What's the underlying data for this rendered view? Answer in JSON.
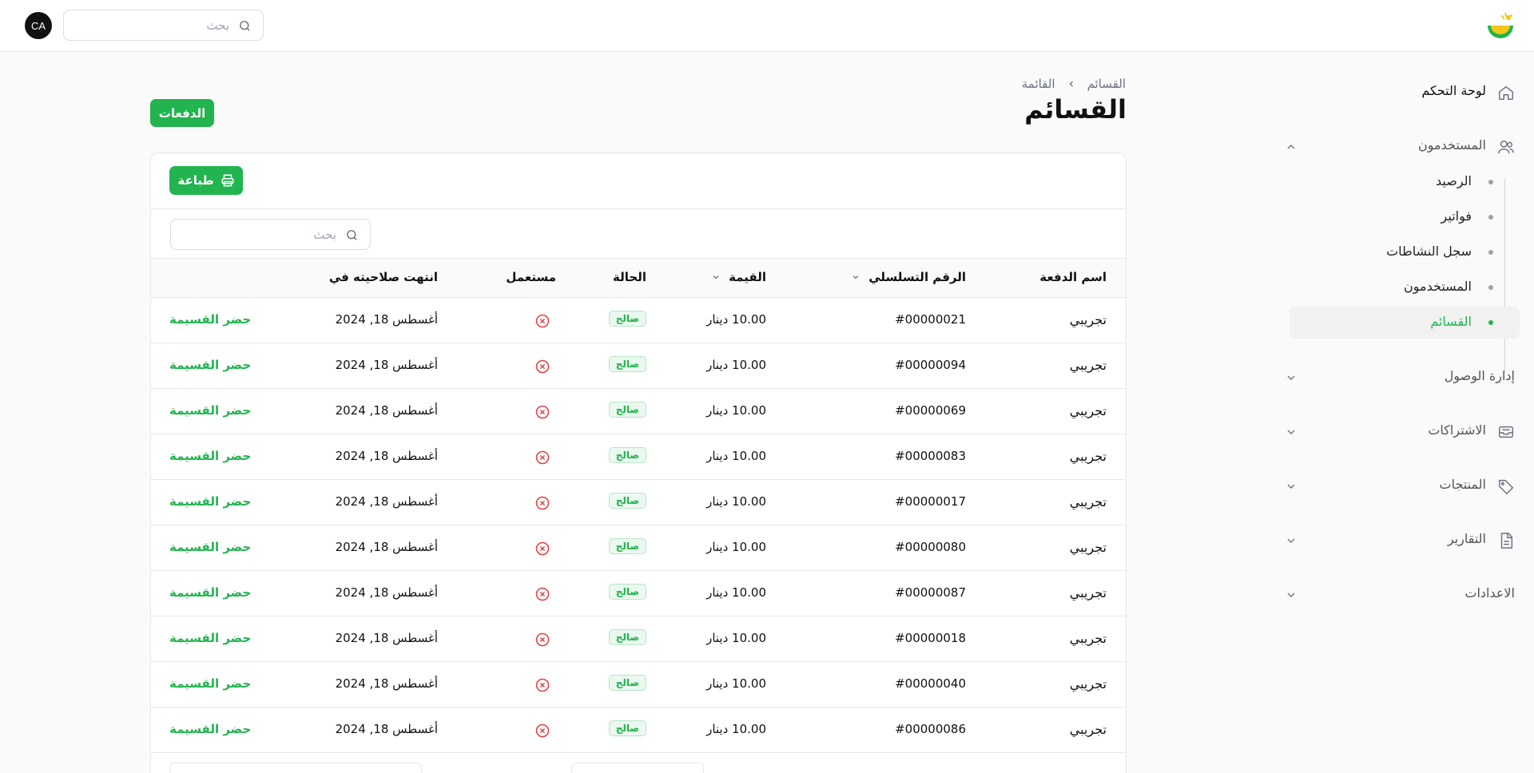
{
  "topbar": {
    "search_placeholder": "بحث",
    "avatar_initials": "CA"
  },
  "sidebar": {
    "dashboard": "لوحة التحكم",
    "users_group": "المستخدمون",
    "sub_items": [
      {
        "label": "الرصيد"
      },
      {
        "label": "فواتير"
      },
      {
        "label": "سجل النشاطات"
      },
      {
        "label": "المستخدمون"
      },
      {
        "label": "القسائم"
      }
    ],
    "access": "إدارة الوصول",
    "subscriptions": "الاشتراكات",
    "products": "المنتجات",
    "reports": "التقارير",
    "settings": "الاعدادات"
  },
  "breadcrumb": {
    "first": "القسائم",
    "second": "القائمة"
  },
  "page_title": "القسائم",
  "payments_button": "الدفعات",
  "print_button": "طباعة",
  "table": {
    "search_placeholder": "بحث",
    "headers": {
      "name": "اسم الدفعة",
      "serial": "الرقم التسلسلي",
      "value": "القيمة",
      "status": "الحالة",
      "used": "مستعمل",
      "expires": "انتهت صلاحيته في"
    },
    "rows": [
      {
        "name": "تجريبي",
        "serial": "#00000021",
        "value": "10.00 دينار",
        "status": "صالح",
        "expires": "أغسطس 18, 2024",
        "action": "حضر القسيمة"
      },
      {
        "name": "تجريبي",
        "serial": "#00000094",
        "value": "10.00 دينار",
        "status": "صالح",
        "expires": "أغسطس 18, 2024",
        "action": "حضر القسيمة"
      },
      {
        "name": "تجريبي",
        "serial": "#00000069",
        "value": "10.00 دينار",
        "status": "صالح",
        "expires": "أغسطس 18, 2024",
        "action": "حضر القسيمة"
      },
      {
        "name": "تجريبي",
        "serial": "#00000083",
        "value": "10.00 دينار",
        "status": "صالح",
        "expires": "أغسطس 18, 2024",
        "action": "حضر القسيمة"
      },
      {
        "name": "تجريبي",
        "serial": "#00000017",
        "value": "10.00 دينار",
        "status": "صالح",
        "expires": "أغسطس 18, 2024",
        "action": "حضر القسيمة"
      },
      {
        "name": "تجريبي",
        "serial": "#00000080",
        "value": "10.00 دينار",
        "status": "صالح",
        "expires": "أغسطس 18, 2024",
        "action": "حضر القسيمة"
      },
      {
        "name": "تجريبي",
        "serial": "#00000087",
        "value": "10.00 دينار",
        "status": "صالح",
        "expires": "أغسطس 18, 2024",
        "action": "حضر القسيمة"
      },
      {
        "name": "تجريبي",
        "serial": "#00000018",
        "value": "10.00 دينار",
        "status": "صالح",
        "expires": "أغسطس 18, 2024",
        "action": "حضر القسيمة"
      },
      {
        "name": "تجريبي",
        "serial": "#00000040",
        "value": "10.00 دينار",
        "status": "صالح",
        "expires": "أغسطس 18, 2024",
        "action": "حضر القسيمة"
      },
      {
        "name": "تجريبي",
        "serial": "#00000086",
        "value": "10.00 دينار",
        "status": "صالح",
        "expires": "أغسطس 18, 2024",
        "action": "حضر القسيمة"
      }
    ]
  },
  "colors": {
    "accent": "#22b44f",
    "danger": "#e53e3e"
  }
}
